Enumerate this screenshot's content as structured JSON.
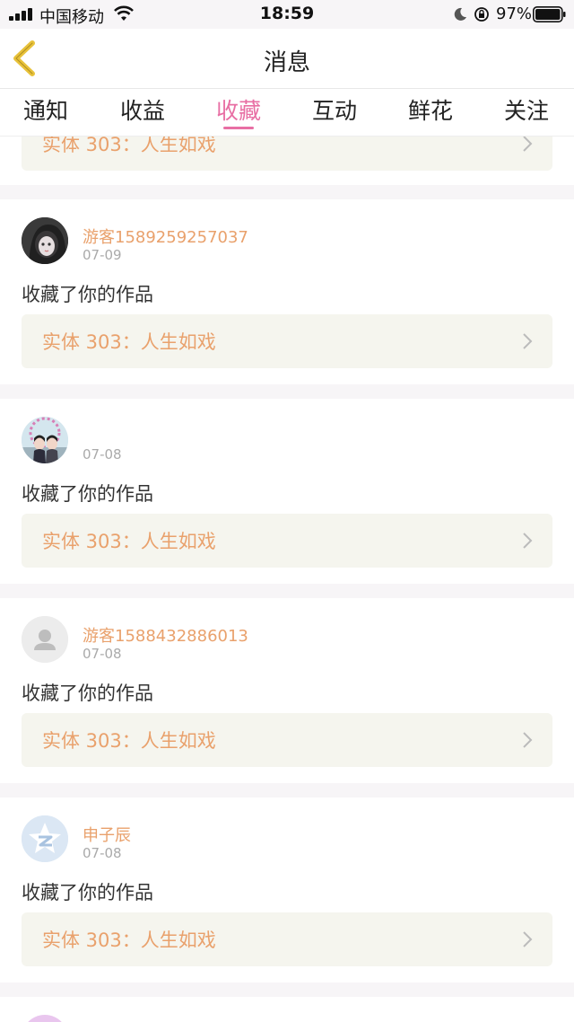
{
  "status_bar": {
    "carrier": "中国移动",
    "time": "18:59",
    "battery": "97%"
  },
  "nav": {
    "title": "消息"
  },
  "tabs": [
    {
      "label": "通知",
      "active": false
    },
    {
      "label": "收益",
      "active": false
    },
    {
      "label": "收藏",
      "active": true
    },
    {
      "label": "互动",
      "active": false
    },
    {
      "label": "鲜花",
      "active": false
    },
    {
      "label": "关注",
      "active": false
    }
  ],
  "items": [
    {
      "user": "",
      "date": "",
      "action": "",
      "work": "实体 303：人生如戏",
      "avatar": "partial"
    },
    {
      "user": "游客1589259257037",
      "date": "07-09",
      "action": "收藏了你的作品",
      "work": "实体 303：人生如戏",
      "avatar": "photo-dark"
    },
    {
      "user": "",
      "date": "07-08",
      "action": "收藏了你的作品",
      "work": "实体 303：人生如戏",
      "avatar": "photo-couple"
    },
    {
      "user": "游客1588432886013",
      "date": "07-08",
      "action": "收藏了你的作品",
      "work": "实体 303：人生如戏",
      "avatar": "default-person-icon"
    },
    {
      "user": "申子辰",
      "date": "07-08",
      "action": "收藏了你的作品",
      "work": "实体 303：人生如戏",
      "avatar": "qzone-icon"
    }
  ],
  "colors": {
    "accent": "#e86fa4",
    "username": "#e9a16c",
    "work_box_bg": "#f5f5ee",
    "back_arrow": "#e8c23a"
  }
}
